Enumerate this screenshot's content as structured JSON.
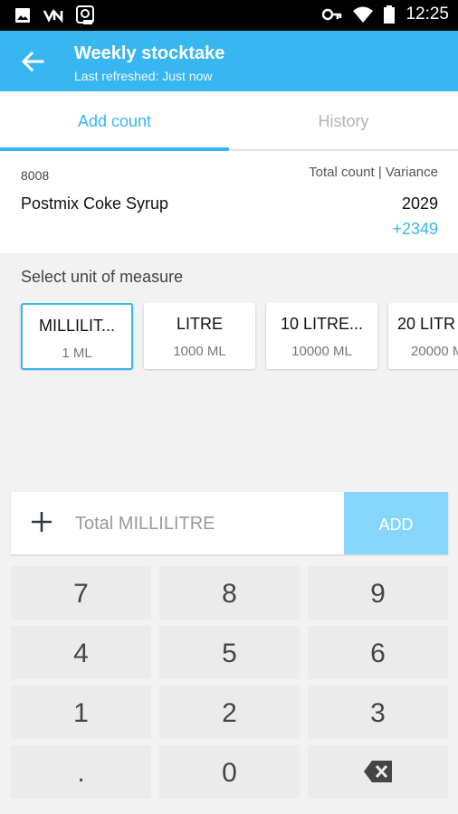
{
  "status_bar": {
    "time": "12:25",
    "icons_left": [
      "image-icon",
      "vn-logo-icon",
      "app-notification-icon"
    ],
    "icons_right": [
      "key-icon",
      "wifi-icon",
      "battery-icon"
    ]
  },
  "app_bar": {
    "title": "Weekly stocktake",
    "subtitle": "Last refreshed: Just now",
    "color": "#38b6f0"
  },
  "tabs": [
    {
      "label": "Add count",
      "active": true
    },
    {
      "label": "History",
      "active": false
    }
  ],
  "item": {
    "code": "8008",
    "name": "Postmix Coke Syrup",
    "count_label": "Total count | Variance",
    "total_count": "2029",
    "variance": "+2349"
  },
  "uom": {
    "label": "Select unit of measure",
    "options": [
      {
        "name": "MILLILIT...",
        "size": "1 ML",
        "selected": true
      },
      {
        "name": "LITRE",
        "size": "1000 ML",
        "selected": false
      },
      {
        "name": "10 LITRE...",
        "size": "10000 ML",
        "selected": false
      },
      {
        "name": "20 LITR",
        "size": "20000 M",
        "selected": false
      }
    ]
  },
  "entry": {
    "placeholder": "Total MILLILITRE",
    "value": "",
    "add_label": "ADD"
  },
  "keypad": {
    "keys": [
      "7",
      "8",
      "9",
      "4",
      "5",
      "6",
      "1",
      "2",
      "3",
      ".",
      "0",
      "backspace"
    ]
  }
}
